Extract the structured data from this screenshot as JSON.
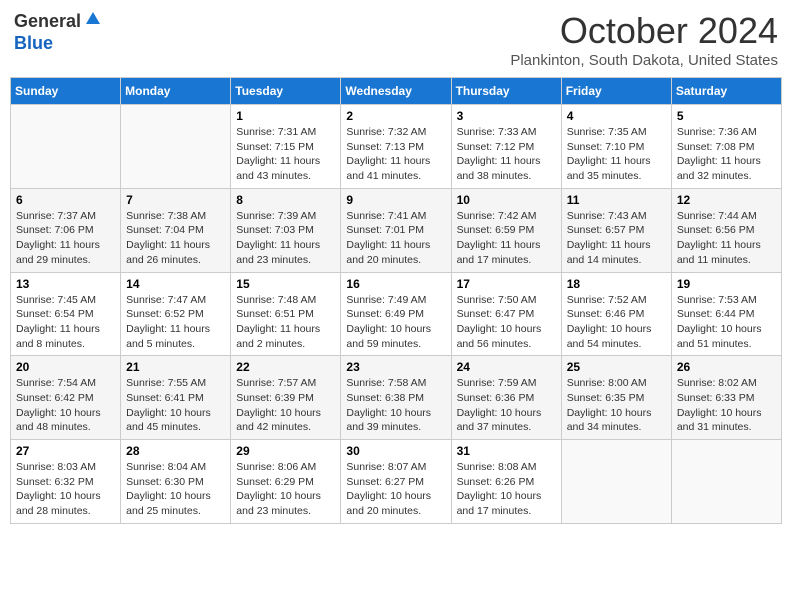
{
  "header": {
    "logo_general": "General",
    "logo_blue": "Blue",
    "month_title": "October 2024",
    "location": "Plankinton, South Dakota, United States"
  },
  "days_of_week": [
    "Sunday",
    "Monday",
    "Tuesday",
    "Wednesday",
    "Thursday",
    "Friday",
    "Saturday"
  ],
  "weeks": [
    [
      {
        "day": "",
        "info": ""
      },
      {
        "day": "",
        "info": ""
      },
      {
        "day": "1",
        "sunrise": "Sunrise: 7:31 AM",
        "sunset": "Sunset: 7:15 PM",
        "daylight": "Daylight: 11 hours and 43 minutes."
      },
      {
        "day": "2",
        "sunrise": "Sunrise: 7:32 AM",
        "sunset": "Sunset: 7:13 PM",
        "daylight": "Daylight: 11 hours and 41 minutes."
      },
      {
        "day": "3",
        "sunrise": "Sunrise: 7:33 AM",
        "sunset": "Sunset: 7:12 PM",
        "daylight": "Daylight: 11 hours and 38 minutes."
      },
      {
        "day": "4",
        "sunrise": "Sunrise: 7:35 AM",
        "sunset": "Sunset: 7:10 PM",
        "daylight": "Daylight: 11 hours and 35 minutes."
      },
      {
        "day": "5",
        "sunrise": "Sunrise: 7:36 AM",
        "sunset": "Sunset: 7:08 PM",
        "daylight": "Daylight: 11 hours and 32 minutes."
      }
    ],
    [
      {
        "day": "6",
        "sunrise": "Sunrise: 7:37 AM",
        "sunset": "Sunset: 7:06 PM",
        "daylight": "Daylight: 11 hours and 29 minutes."
      },
      {
        "day": "7",
        "sunrise": "Sunrise: 7:38 AM",
        "sunset": "Sunset: 7:04 PM",
        "daylight": "Daylight: 11 hours and 26 minutes."
      },
      {
        "day": "8",
        "sunrise": "Sunrise: 7:39 AM",
        "sunset": "Sunset: 7:03 PM",
        "daylight": "Daylight: 11 hours and 23 minutes."
      },
      {
        "day": "9",
        "sunrise": "Sunrise: 7:41 AM",
        "sunset": "Sunset: 7:01 PM",
        "daylight": "Daylight: 11 hours and 20 minutes."
      },
      {
        "day": "10",
        "sunrise": "Sunrise: 7:42 AM",
        "sunset": "Sunset: 6:59 PM",
        "daylight": "Daylight: 11 hours and 17 minutes."
      },
      {
        "day": "11",
        "sunrise": "Sunrise: 7:43 AM",
        "sunset": "Sunset: 6:57 PM",
        "daylight": "Daylight: 11 hours and 14 minutes."
      },
      {
        "day": "12",
        "sunrise": "Sunrise: 7:44 AM",
        "sunset": "Sunset: 6:56 PM",
        "daylight": "Daylight: 11 hours and 11 minutes."
      }
    ],
    [
      {
        "day": "13",
        "sunrise": "Sunrise: 7:45 AM",
        "sunset": "Sunset: 6:54 PM",
        "daylight": "Daylight: 11 hours and 8 minutes."
      },
      {
        "day": "14",
        "sunrise": "Sunrise: 7:47 AM",
        "sunset": "Sunset: 6:52 PM",
        "daylight": "Daylight: 11 hours and 5 minutes."
      },
      {
        "day": "15",
        "sunrise": "Sunrise: 7:48 AM",
        "sunset": "Sunset: 6:51 PM",
        "daylight": "Daylight: 11 hours and 2 minutes."
      },
      {
        "day": "16",
        "sunrise": "Sunrise: 7:49 AM",
        "sunset": "Sunset: 6:49 PM",
        "daylight": "Daylight: 10 hours and 59 minutes."
      },
      {
        "day": "17",
        "sunrise": "Sunrise: 7:50 AM",
        "sunset": "Sunset: 6:47 PM",
        "daylight": "Daylight: 10 hours and 56 minutes."
      },
      {
        "day": "18",
        "sunrise": "Sunrise: 7:52 AM",
        "sunset": "Sunset: 6:46 PM",
        "daylight": "Daylight: 10 hours and 54 minutes."
      },
      {
        "day": "19",
        "sunrise": "Sunrise: 7:53 AM",
        "sunset": "Sunset: 6:44 PM",
        "daylight": "Daylight: 10 hours and 51 minutes."
      }
    ],
    [
      {
        "day": "20",
        "sunrise": "Sunrise: 7:54 AM",
        "sunset": "Sunset: 6:42 PM",
        "daylight": "Daylight: 10 hours and 48 minutes."
      },
      {
        "day": "21",
        "sunrise": "Sunrise: 7:55 AM",
        "sunset": "Sunset: 6:41 PM",
        "daylight": "Daylight: 10 hours and 45 minutes."
      },
      {
        "day": "22",
        "sunrise": "Sunrise: 7:57 AM",
        "sunset": "Sunset: 6:39 PM",
        "daylight": "Daylight: 10 hours and 42 minutes."
      },
      {
        "day": "23",
        "sunrise": "Sunrise: 7:58 AM",
        "sunset": "Sunset: 6:38 PM",
        "daylight": "Daylight: 10 hours and 39 minutes."
      },
      {
        "day": "24",
        "sunrise": "Sunrise: 7:59 AM",
        "sunset": "Sunset: 6:36 PM",
        "daylight": "Daylight: 10 hours and 37 minutes."
      },
      {
        "day": "25",
        "sunrise": "Sunrise: 8:00 AM",
        "sunset": "Sunset: 6:35 PM",
        "daylight": "Daylight: 10 hours and 34 minutes."
      },
      {
        "day": "26",
        "sunrise": "Sunrise: 8:02 AM",
        "sunset": "Sunset: 6:33 PM",
        "daylight": "Daylight: 10 hours and 31 minutes."
      }
    ],
    [
      {
        "day": "27",
        "sunrise": "Sunrise: 8:03 AM",
        "sunset": "Sunset: 6:32 PM",
        "daylight": "Daylight: 10 hours and 28 minutes."
      },
      {
        "day": "28",
        "sunrise": "Sunrise: 8:04 AM",
        "sunset": "Sunset: 6:30 PM",
        "daylight": "Daylight: 10 hours and 25 minutes."
      },
      {
        "day": "29",
        "sunrise": "Sunrise: 8:06 AM",
        "sunset": "Sunset: 6:29 PM",
        "daylight": "Daylight: 10 hours and 23 minutes."
      },
      {
        "day": "30",
        "sunrise": "Sunrise: 8:07 AM",
        "sunset": "Sunset: 6:27 PM",
        "daylight": "Daylight: 10 hours and 20 minutes."
      },
      {
        "day": "31",
        "sunrise": "Sunrise: 8:08 AM",
        "sunset": "Sunset: 6:26 PM",
        "daylight": "Daylight: 10 hours and 17 minutes."
      },
      {
        "day": "",
        "info": ""
      },
      {
        "day": "",
        "info": ""
      }
    ]
  ]
}
